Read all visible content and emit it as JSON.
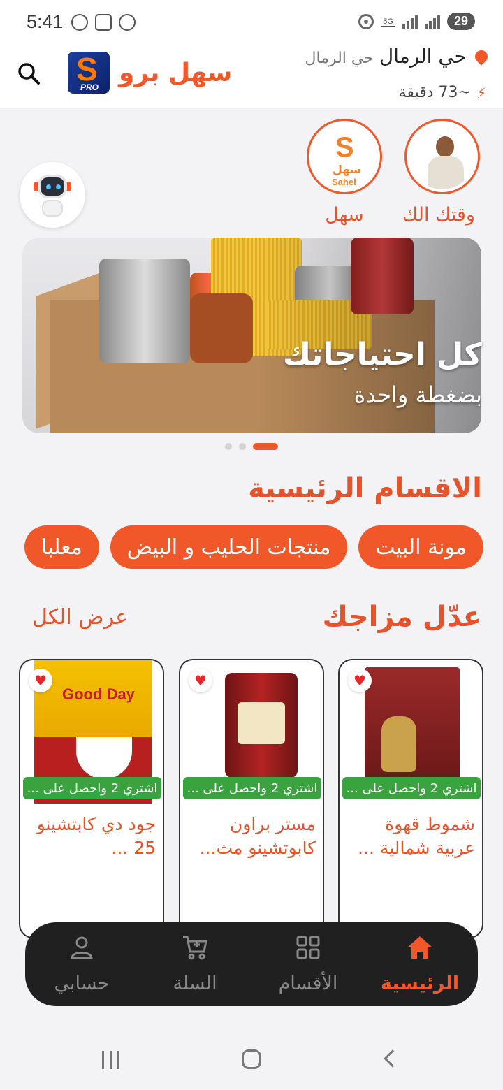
{
  "status_bar": {
    "time": "5:41",
    "battery": "29",
    "network": "5G"
  },
  "header": {
    "brand_name": "سهل برو",
    "logo_letter": "S",
    "logo_sub": "PRO",
    "location_main": "حي الرمال",
    "location_sub": "حي الرمال",
    "eta": "~73 دقيقة"
  },
  "stories": [
    {
      "label": "وقتك الك",
      "icon": "person-photo"
    },
    {
      "label": "سهل",
      "icon": "sahel-logo",
      "logo_letter": "S",
      "logo_ar": "سهل",
      "logo_en": "Sahel"
    }
  ],
  "banner": {
    "title": "كل احتياجاتك",
    "subtitle": "بضغطة واحدة",
    "pages": 3,
    "active_page": 3
  },
  "main_sections": {
    "title": "الاقسام الرئيسية",
    "chips": [
      "مونة البيت",
      "منتجات الحليب و البيض",
      "معلبا"
    ]
  },
  "mood": {
    "title": "عدّل مزاجك",
    "view_all": "عرض الكل",
    "products": [
      {
        "name": "شموط قهوة عربية شمالية ...",
        "offer": "اشتري 2 واحصل على ...",
        "favorite": true
      },
      {
        "name": "مستر براون كابوتشينو مث...",
        "offer": "اشتري 2 واحصل على ...",
        "favorite": true
      },
      {
        "name": "جود دي كابتشينو 25 ...",
        "offer": "اشتري 2 واحصل على ...",
        "favorite": true
      }
    ]
  },
  "bottom_nav": [
    {
      "label": "الرئيسية",
      "icon": "home-icon",
      "active": true
    },
    {
      "label": "الأقسام",
      "icon": "grid-icon",
      "active": false
    },
    {
      "label": "السلة",
      "icon": "cart-icon",
      "active": false
    },
    {
      "label": "حسابي",
      "icon": "person-icon",
      "active": false
    }
  ],
  "colors": {
    "accent": "#f0582a",
    "offer": "#3aa33f",
    "nav_bg": "#202020"
  }
}
